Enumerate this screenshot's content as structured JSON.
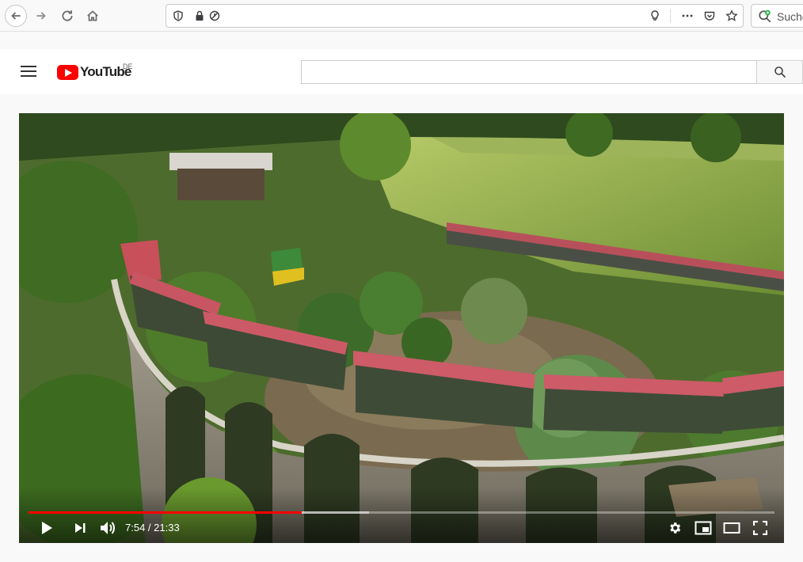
{
  "browser": {
    "url": "",
    "search_placeholder": "Suche"
  },
  "youtube": {
    "logo_text": "YouTube",
    "region": "DE",
    "search_value": ""
  },
  "player": {
    "current_time": "7:54",
    "duration": "21:33",
    "time_display": "7:54 / 21:33",
    "progress_fraction": 0.3666,
    "accent_color": "#ff0000"
  },
  "icons": {
    "back": "arrow-left-icon",
    "forward": "arrow-right-icon",
    "reload": "reload-icon",
    "home": "home-icon",
    "shield": "shield-icon",
    "lock": "lock-icon",
    "mic_off": "mic-off-icon",
    "bulb": "bulb-icon",
    "more": "more-icon",
    "pocket": "pocket-icon",
    "star": "star-icon",
    "search": "search-icon",
    "play": "play-icon",
    "next": "next-icon",
    "volume": "volume-icon",
    "settings": "gear-icon",
    "miniplayer": "miniplayer-icon",
    "theater": "theater-icon",
    "fullscreen": "fullscreen-icon"
  }
}
